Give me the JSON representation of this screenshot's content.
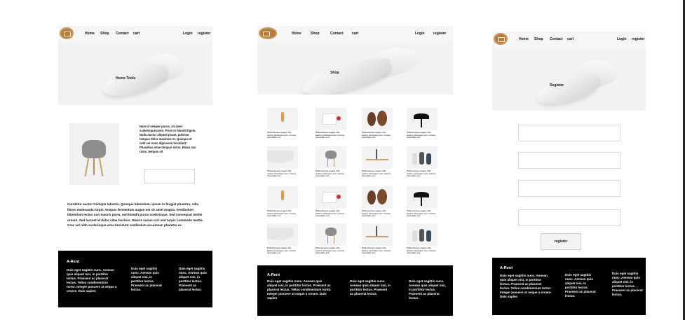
{
  "nav": {
    "home": "Home",
    "shop": "Shop",
    "contact": "Contact",
    "cart": "cart",
    "login": "Login",
    "register": "register"
  },
  "page1": {
    "hero_title": "Home Tools",
    "desc": "Nam id semper purus, sit amet scelerisque justo. Proin in blandit ligula. Nulla auctor aliquet ipsum, pulvinar tempus dolor maximus et. Quisque et velit vel nunc dignissim tincidunt. Phasellus vitae tempus tortor. Etiam nisi risus, tempus sit",
    "body": "Curabitur auctor tristique lobortis. Quisque bibendum, ipsum in feugiat pharetra, odio libero malesuada turpis, tempus fermentum augue est sit amet magna. Vestibulum bibendum lectus non mauris porta, sed blandit purus scelerisque. Sed consequat mollis ornare. Sed laoreet id dolor vitae facilisis. Mauris varius orci sed turpis commodo mattis. Cras vel nibh scelerisque urna tincidunt vestibulum accumsan pharetra ex."
  },
  "page2": {
    "hero_title": "Shop",
    "caption": "Pellentesque augue nisl, auctor id tempor nec, cursus venenatis est."
  },
  "page3": {
    "hero_title": "Register",
    "register_button": "register"
  },
  "footer": {
    "brand": "A-Rent",
    "col1": "Duis eget sagittis nunc. Aenean quis aliquet nisi, in porttitor lectus. Praesent ac placerat lectus. Tellus condimentum tortor. Integer posuere at neque a ornare. Duis sapien",
    "col2": "Duis eget sagittis nunc. Aenean quis aliquet nisi, in porttitor lectus. Praesent ac placerat lectus.",
    "col3": "Duis eget sagittis nunc. Aenean quis aliquet nisi, in porttitor lectus. Praesent ac placerat lectus."
  }
}
